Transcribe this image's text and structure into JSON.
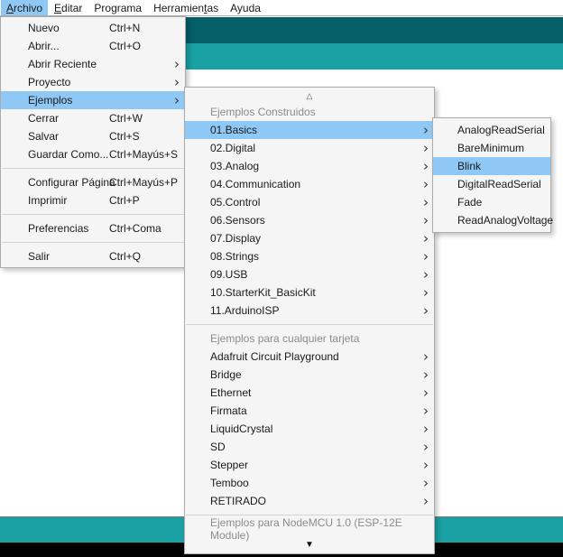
{
  "colors": {
    "teal_dark": "#045f66",
    "teal_light": "#1aa1a3",
    "menu_highlight": "#8fc8f5",
    "menu_background": "#f5f5f5",
    "header_text": "#8b8b8b",
    "console_black": "#000000"
  },
  "glyphs": {
    "submenu_arrow": "›",
    "scroll_up": "△",
    "scroll_down": "▼"
  },
  "menubar": {
    "items": [
      {
        "pre": "",
        "accel": "A",
        "post": "rchivo"
      },
      {
        "pre": "",
        "accel": "E",
        "post": "ditar"
      },
      {
        "pre": "Programa",
        "accel": "",
        "post": ""
      },
      {
        "pre": "Herramien",
        "accel": "t",
        "post": "as"
      },
      {
        "pre": "Ayuda",
        "accel": "",
        "post": ""
      }
    ]
  },
  "file_menu": {
    "items": [
      {
        "label": "Nuevo",
        "shortcut": "Ctrl+N"
      },
      {
        "label": "Abrir...",
        "shortcut": "Ctrl+O"
      },
      {
        "label": "Abrir Reciente"
      },
      {
        "label": "Proyecto"
      },
      {
        "label": "Ejemplos"
      },
      {
        "label": "Cerrar",
        "shortcut": "Ctrl+W"
      },
      {
        "label": "Salvar",
        "shortcut": "Ctrl+S"
      },
      {
        "label": "Guardar Como...",
        "shortcut": "Ctrl+Mayús+S"
      },
      {
        "label": "Configurar Página",
        "shortcut": "Ctrl+Mayús+P"
      },
      {
        "label": "Imprimir",
        "shortcut": "Ctrl+P"
      },
      {
        "label": "Preferencias",
        "shortcut": "Ctrl+Coma"
      },
      {
        "label": "Salir",
        "shortcut": "Ctrl+Q"
      }
    ]
  },
  "examples_menu": {
    "builtin_header": "Ejemplos Construidos",
    "builtin_items": [
      "01.Basics",
      "02.Digital",
      "03.Analog",
      "04.Communication",
      "05.Control",
      "06.Sensors",
      "07.Display",
      "08.Strings",
      "09.USB",
      "10.StarterKit_BasicKit",
      "11.ArduinoISP"
    ],
    "any_board_header": "Ejemplos para cualquier tarjeta",
    "any_board_items": [
      "Adafruit Circuit Playground",
      "Bridge",
      "Ethernet",
      "Firmata",
      "LiquidCrystal",
      "SD",
      "Stepper",
      "Temboo",
      "RETIRADO"
    ],
    "board_header": "Ejemplos para NodeMCU 1.0 (ESP-12E Module)"
  },
  "basics_menu": {
    "items": [
      "AnalogReadSerial",
      "BareMinimum",
      "Blink",
      "DigitalReadSerial",
      "Fade",
      "ReadAnalogVoltage"
    ]
  }
}
